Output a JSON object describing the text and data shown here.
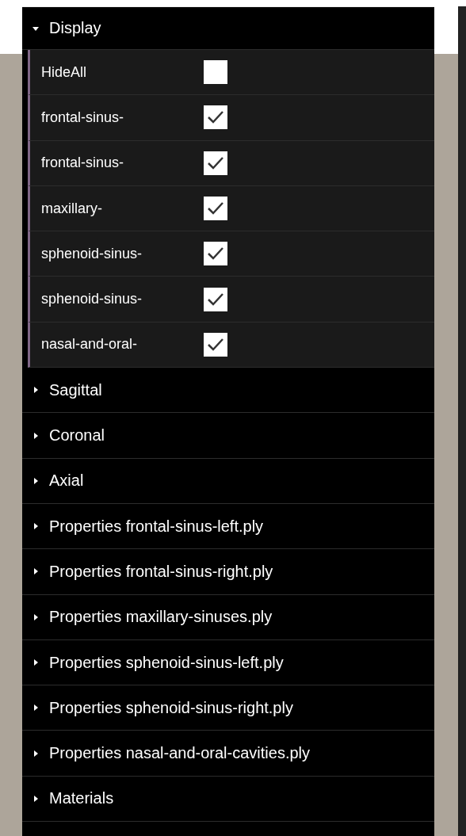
{
  "folders": [
    {
      "title": "Display",
      "expanded": true,
      "controls": [
        {
          "label": "HideAll",
          "checked": false
        },
        {
          "label": "frontal-sinus-",
          "checked": true
        },
        {
          "label": "frontal-sinus-",
          "checked": true
        },
        {
          "label": "maxillary-",
          "checked": true
        },
        {
          "label": "sphenoid-sinus-",
          "checked": true
        },
        {
          "label": "sphenoid-sinus-",
          "checked": true
        },
        {
          "label": "nasal-and-oral-",
          "checked": true
        }
      ]
    },
    {
      "title": "Sagittal",
      "expanded": false
    },
    {
      "title": "Coronal",
      "expanded": false
    },
    {
      "title": "Axial",
      "expanded": false
    },
    {
      "title": "Properties frontal-sinus-left.ply",
      "expanded": false
    },
    {
      "title": "Properties frontal-sinus-right.ply",
      "expanded": false
    },
    {
      "title": "Properties maxillary-sinuses.ply",
      "expanded": false
    },
    {
      "title": "Properties sphenoid-sinus-left.ply",
      "expanded": false
    },
    {
      "title": "Properties sphenoid-sinus-right.ply",
      "expanded": false
    },
    {
      "title": "Properties nasal-and-oral-cavities.ply",
      "expanded": false
    },
    {
      "title": "Materials",
      "expanded": false
    }
  ]
}
